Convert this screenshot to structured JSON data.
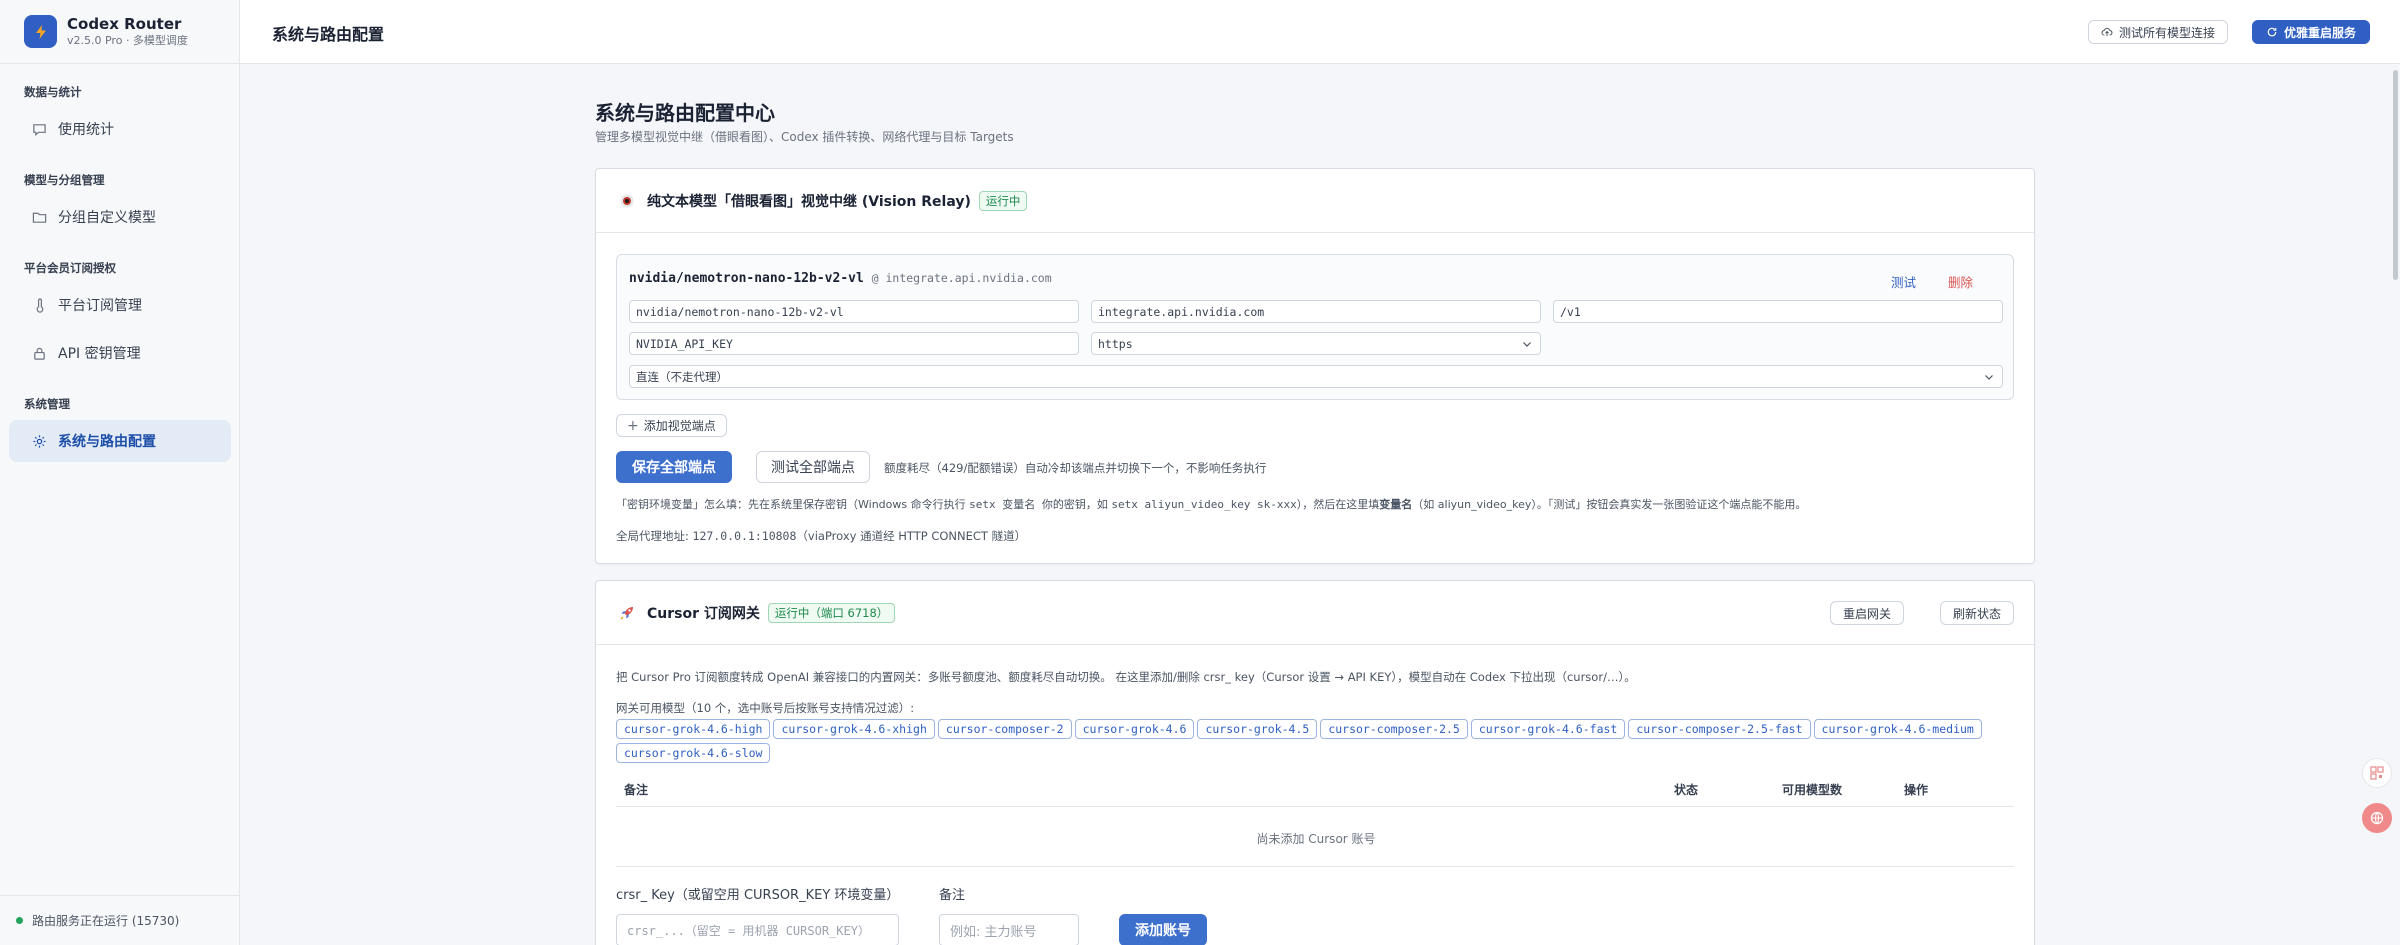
{
  "app": {
    "name": "Codex Router",
    "version": "v2.5.0 Pro · 多模型调度"
  },
  "sidebar": {
    "groups": [
      {
        "label": "数据与统计",
        "items": [
          {
            "label": "使用统计",
            "icon": "chat-bubble-icon"
          }
        ]
      },
      {
        "label": "模型与分组管理",
        "items": [
          {
            "label": "分组自定义模型",
            "icon": "folder-icon"
          }
        ]
      },
      {
        "label": "平台会员订阅授权",
        "items": [
          {
            "label": "平台订阅管理",
            "icon": "thermometer-icon"
          },
          {
            "label": "API 密钥管理",
            "icon": "lock-icon"
          }
        ]
      },
      {
        "label": "系统管理",
        "items": [
          {
            "label": "系统与路由配置",
            "icon": "gear-icon",
            "active": true
          }
        ]
      }
    ],
    "footer_status": "路由服务正在运行 (15730)"
  },
  "topbar": {
    "title": "系统与路由配置",
    "test_all_label": "测试所有模型连接",
    "restart_label": "优雅重启服务"
  },
  "page": {
    "title": "系统与路由配置中心",
    "subtitle": "管理多模型视觉中继（借眼看图）、Codex 插件转换、网络代理与目标 Targets"
  },
  "vision_relay": {
    "title": "纯文本模型「借眼看图」视觉中继 (Vision Relay)",
    "status": "运行中",
    "endpoint": {
      "model": "nvidia/nemotron-nano-12b-v2-vl",
      "host_suffix": "@ integrate.api.nvidia.com",
      "test_label": "测试",
      "delete_label": "删除",
      "model_field": "nvidia/nemotron-nano-12b-v2-vl",
      "host_field": "integrate.api.nvidia.com",
      "path_field": "/v1",
      "key_env_field": "NVIDIA_API_KEY",
      "protocol_field": "https",
      "proxy_field": "直连（不走代理）"
    },
    "add_endpoint_label": "添加视觉端点",
    "save_all_label": "保存全部端点",
    "test_all_label": "测试全部端点",
    "quota_note": "额度耗尽（429/配额错误）自动冷却该端点并切换下一个，不影响任务执行",
    "help_text_1": "「密钥环境变量」怎么填：先在系统里保存密钥（Windows 命令行执行",
    "help_code_1": "setx 变量名 你的密钥",
    "help_text_2": "，如",
    "help_code_2": "setx aliyun_video_key sk-xxx",
    "help_text_3": "），然后在这里填",
    "help_bold": "变量名",
    "help_text_4": "（如 aliyun_video_key）。「测试」按钮会真实发一张图验证这个端点能不能用。",
    "proxy_prefix": "全局代理地址: ",
    "proxy_addr": "127.0.0.1:10808",
    "proxy_suffix": "（viaProxy 通道经 HTTP CONNECT 隧道）"
  },
  "cursor_gateway": {
    "title": "Cursor 订阅网关",
    "status": "运行中（端口 6718）",
    "restart_label": "重启网关",
    "refresh_label": "刷新状态",
    "description": "把 Cursor Pro 订阅额度转成 OpenAI 兼容接口的内置网关：多账号额度池、额度耗尽自动切换。 在这里添加/删除 crsr_ key（Cursor 设置 → API KEY），模型自动在 Codex 下拉出现（cursor/…）。",
    "models_label": "网关可用模型（10 个，选中账号后按账号支持情况过滤）:",
    "models": [
      "cursor-grok-4.6-high",
      "cursor-grok-4.6-xhigh",
      "cursor-composer-2",
      "cursor-grok-4.6",
      "cursor-grok-4.5",
      "cursor-composer-2.5",
      "cursor-grok-4.6-fast",
      "cursor-composer-2.5-fast",
      "cursor-grok-4.6-medium",
      "cursor-grok-4.6-slow"
    ],
    "table_headers": {
      "note": "备注",
      "status": "状态",
      "models": "可用模型数",
      "actions": "操作"
    },
    "empty_text": "尚未添加 Cursor 账号",
    "key_label": "crsr_ Key（或留空用 CURSOR_KEY 环境变量）",
    "key_placeholder": "crsr_...（留空 = 用机器 CURSOR_KEY）",
    "note_label": "备注",
    "note_placeholder": "例如: 主力账号",
    "add_label": "添加账号"
  },
  "colors": {
    "primary": "#2f5fc2",
    "success": "#1f8a4c",
    "danger": "#d9534f"
  }
}
